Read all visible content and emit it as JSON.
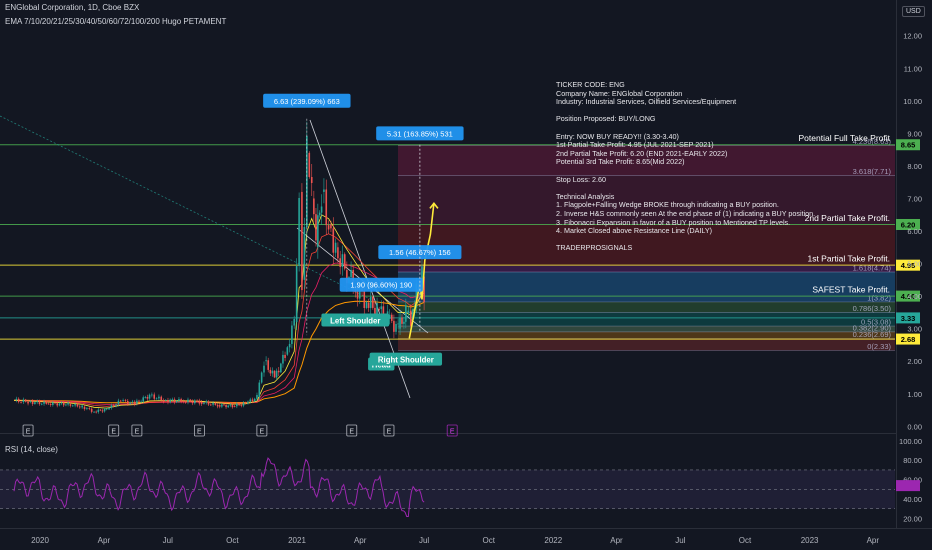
{
  "header": {
    "symbol_line": "ENGlobal Corporation, 1D, Cboe BZX",
    "indicator_line": "EMA 7/10/20/21/25/30/40/50/60/72/100/200 Hugo PETAMENT"
  },
  "currency_badge": "USD",
  "rsi_label": "RSI (14, close)",
  "analysis_text": [
    "TICKER CODE: ENG",
    "Company Name: ENGlobal Corporation",
    "Industry: Industrial Services, Oilfield Services/Equipment",
    "",
    "Position Proposed: BUY/LONG",
    "",
    "Entry: NOW BUY READY!! (3.30-3.40)",
    "1st Partial Take Profit: 4.95 (JUL 2021-SEP 2021)",
    "2nd Partial Take Profit: 6.20 (END 2021-EARLY 2022)",
    "Potential 3rd Take Profit: 8.65(Mid 2022)",
    "",
    "Stop Loss: 2.60",
    "",
    "Technical Analysis",
    "1. Flagpole+Falling Wedge BROKE through indicating a BUY position.",
    "2. Inverse H&S commonly seen At the end phase of (1) indicating a BUY position.",
    "3. Fibonacci Expansion in favor of a BUY position to Mentioned TP levels.",
    "4. Market Closed above Resistance Line (DAILY)",
    "",
    "TRADERPROSIGNALS"
  ],
  "colors": {
    "background": "#131722",
    "candle_up": "#26a69a",
    "candle_down": "#ef5350",
    "level_green": "#4caf50",
    "level_yellow": "#ffeb3b",
    "rsi": "#9c27b0",
    "fib_blue": "#2962ff"
  },
  "chart_data": {
    "type": "candlestick",
    "title": "ENGlobal Corporation, 1D, Cboe BZX",
    "price_axis": {
      "ticks": [
        "12.00",
        "11.00",
        "10.00",
        "9.00",
        "8.00",
        "7.00",
        "6.00",
        "5.00",
        "4.00",
        "3.00",
        "2.00",
        "1.00",
        "0.00"
      ],
      "ylim": [
        0,
        12.6
      ]
    },
    "time_axis": {
      "ticks": [
        "2020",
        "Apr",
        "Jul",
        "Oct",
        "2021",
        "Apr",
        "Jul",
        "Oct",
        "2022",
        "Apr",
        "Jul",
        "Oct",
        "2023",
        "Apr"
      ]
    },
    "price_path": [
      [
        "2019-11-25",
        0.8
      ],
      [
        "2019-12-15",
        0.75
      ],
      [
        "2020-01-10",
        0.7
      ],
      [
        "2020-02-10",
        0.68
      ],
      [
        "2020-03-01",
        0.6
      ],
      [
        "2020-03-18",
        0.45
      ],
      [
        "2020-04-05",
        0.52
      ],
      [
        "2020-04-25",
        0.78
      ],
      [
        "2020-05-15",
        0.7
      ],
      [
        "2020-06-05",
        0.95
      ],
      [
        "2020-06-25",
        0.8
      ],
      [
        "2020-07-20",
        0.78
      ],
      [
        "2020-08-15",
        0.75
      ],
      [
        "2020-09-10",
        0.65
      ],
      [
        "2020-10-01",
        0.62
      ],
      [
        "2020-10-20",
        0.7
      ],
      [
        "2020-11-05",
        0.9
      ],
      [
        "2020-11-15",
        2.0
      ],
      [
        "2020-11-30",
        1.5
      ],
      [
        "2020-12-15",
        2.2
      ],
      [
        "2020-12-28",
        3.2
      ],
      [
        "2021-01-04",
        7.2
      ],
      [
        "2021-01-08",
        4.5
      ],
      [
        "2021-01-15",
        8.4
      ],
      [
        "2021-01-22",
        7.0
      ],
      [
        "2021-01-28",
        5.5
      ],
      [
        "2021-02-05",
        7.2
      ],
      [
        "2021-02-15",
        6.2
      ],
      [
        "2021-02-25",
        5.5
      ],
      [
        "2021-03-10",
        4.8
      ],
      [
        "2021-03-25",
        4.3
      ],
      [
        "2021-04-10",
        3.8
      ],
      [
        "2021-04-25",
        3.6
      ],
      [
        "2021-05-10",
        3.3
      ],
      [
        "2021-05-25",
        3.0
      ],
      [
        "2021-06-05",
        3.5
      ],
      [
        "2021-06-12",
        3.3
      ],
      [
        "2021-06-20",
        4.2
      ],
      [
        "2021-06-28",
        4.6
      ],
      [
        "2021-07-01",
        4.1
      ]
    ],
    "levels": [
      {
        "label": "Potential Full Take Profit",
        "price": 8.65
      },
      {
        "label": "2nd Partial Take Profit.",
        "price": 6.2
      },
      {
        "label": "1st Partial Take Profit.",
        "price": 4.95
      },
      {
        "label": "SAFEST Take Profit.",
        "price": 4.0
      },
      {
        "price": 3.33
      },
      {
        "price": 2.68
      }
    ],
    "fib_levels": [
      {
        "label": "4.236(8.63)",
        "price": 8.63
      },
      {
        "label": "3.618(7.71)",
        "price": 7.71
      },
      {
        "label": "1.618(4.74)",
        "price": 4.74
      },
      {
        "label": "1(3.82)",
        "price": 3.82
      },
      {
        "label": "0.786(3.50)",
        "price": 3.5
      },
      {
        "label": "0.5(3.08)",
        "price": 3.08
      },
      {
        "label": "0.382(2.90)",
        "price": 2.9
      },
      {
        "label": "0.236(2.69)",
        "price": 2.69
      },
      {
        "label": "0(2.33)",
        "price": 2.33
      }
    ],
    "measurements": [
      {
        "label": "6.63 (239.09%) 663",
        "date": "2021-01-15",
        "price": 10.0
      },
      {
        "label": "5.31 (163.85%) 531",
        "date": "2021-06-25",
        "price": 9.0
      },
      {
        "label": "1.56 (46.67%) 156",
        "date": "2021-06-25",
        "price": 5.35
      },
      {
        "label": "1.90 (96.60%) 190",
        "date": "2021-05-01",
        "price": 4.35
      }
    ],
    "pattern_labels": [
      {
        "label": "Left Shoulder",
        "date": "2021-03-25",
        "price": 3.25
      },
      {
        "label": "Head",
        "date": "2021-05-01",
        "price": 1.9
      },
      {
        "label": "Right Shoulder",
        "date": "2021-06-05",
        "price": 2.05
      }
    ],
    "earnings_markers": [
      "2019-12-15",
      "2020-04-15",
      "2020-05-18",
      "2020-08-15",
      "2020-11-12",
      "2021-03-20",
      "2021-05-12",
      "2021-08-10"
    ],
    "rsi": {
      "label": "RSI (14, close)",
      "ticks": [
        "100.00",
        "80.00",
        "60.00",
        "40.00",
        "20.00"
      ],
      "ylim": [
        15,
        100
      ],
      "bands": [
        30,
        50,
        70
      ]
    }
  }
}
